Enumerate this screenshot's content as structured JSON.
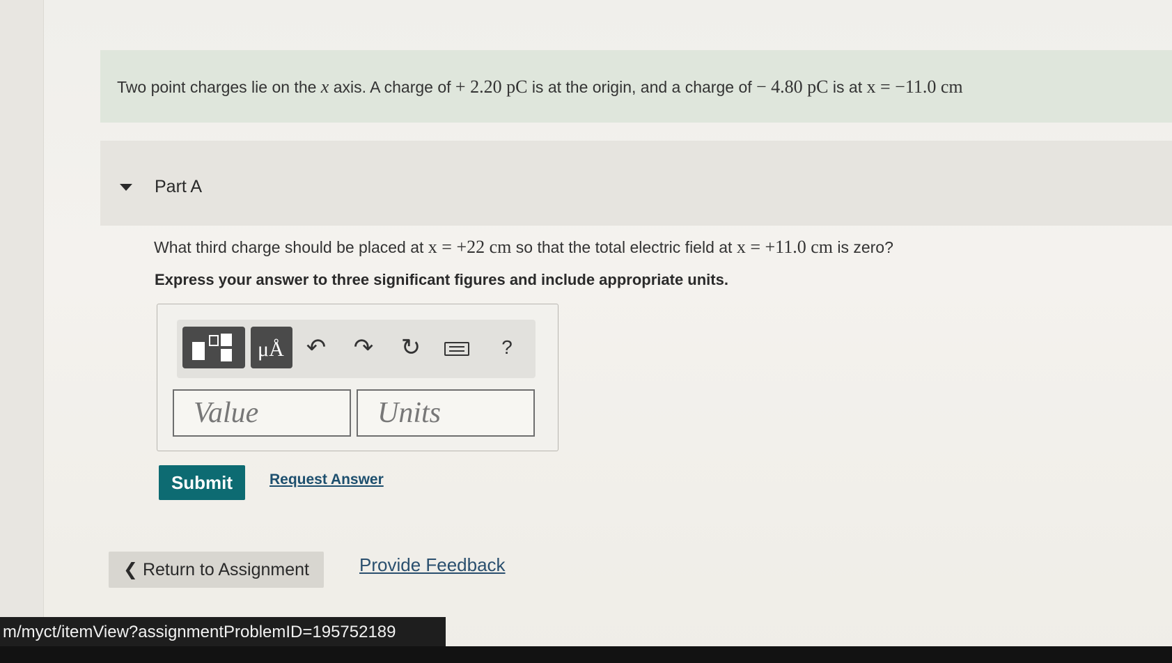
{
  "problem": {
    "intro_prefix": "Two point charges lie on the",
    "intro_var": "x",
    "intro_mid1": "axis. A charge of",
    "charge1": "+ 2.20 pC",
    "intro_mid2": "is at the origin, and a charge of",
    "charge2": "− 4.80 pC",
    "intro_mid3": "is at",
    "pos2": "x = −11.0 cm"
  },
  "part": {
    "title": "Part A",
    "q_prefix": "What third charge should be placed at",
    "q_pos": "x = +22 cm",
    "q_mid": "so that the total electric field at",
    "q_pos2": "x = +11.0 cm",
    "q_suffix": "is zero?",
    "instruction": "Express your answer to three significant figures and include appropriate units."
  },
  "toolbar": {
    "units_label": "μÅ",
    "undo": "↶",
    "redo": "↷",
    "reset": "↻",
    "help": "?"
  },
  "inputs": {
    "value_placeholder": "Value",
    "units_placeholder": "Units"
  },
  "actions": {
    "submit": "Submit",
    "request_answer": "Request Answer",
    "return_to_assignment": "Return to Assignment",
    "provide_feedback": "Provide Feedback"
  },
  "status_url": "m/myct/itemView?assignmentProblemID=195752189",
  "colors": {
    "submit_bg": "#0d6b72",
    "intro_bg": "#dfe6dc"
  }
}
